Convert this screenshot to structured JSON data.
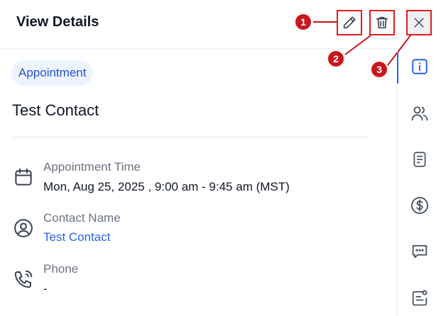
{
  "header": {
    "title": "View Details",
    "edit_icon": "pencil-icon",
    "delete_icon": "trash-icon",
    "close_icon": "close-icon"
  },
  "callouts": [
    "1",
    "2",
    "3"
  ],
  "tag": "Appointment",
  "contact_title": "Test Contact",
  "rows": [
    {
      "icon": "calendar-icon",
      "label": "Appointment Time",
      "value": "Mon, Aug 25, 2025 , 9:00 am - 9:45 am (MST)"
    },
    {
      "icon": "user-circle-icon",
      "label": "Contact Name",
      "value": "Test Contact"
    },
    {
      "icon": "phone-icon",
      "label": "Phone",
      "value": "-"
    }
  ],
  "rail": [
    "info-icon",
    "users-icon",
    "notes-icon",
    "dollar-icon",
    "chat-icon",
    "card-icon"
  ],
  "colors": {
    "accent": "#2563eb",
    "callout": "#c8161d",
    "highlight": "#e11d1d"
  }
}
